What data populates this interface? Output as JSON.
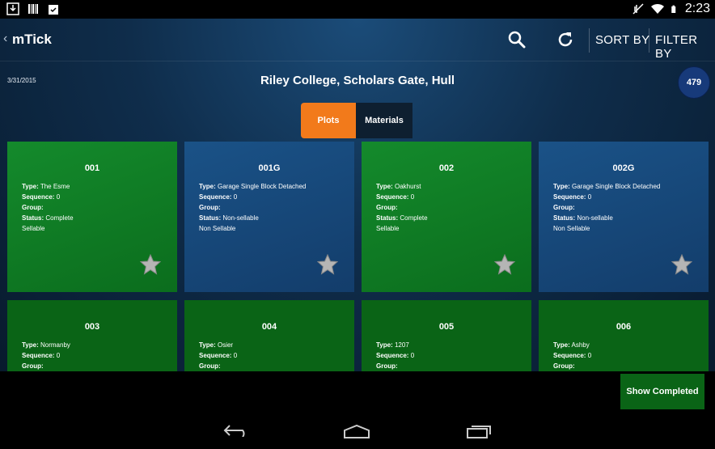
{
  "status": {
    "time": "2:23",
    "left_icons": [
      "download-icon",
      "barcode-icon",
      "clipboard-check-icon"
    ],
    "right_icons": [
      "mute-icon",
      "wifi-icon",
      "battery-icon"
    ]
  },
  "appbar": {
    "title": "mTick",
    "sort_label": "SORT BY",
    "filter_label": "FILTER BY",
    "icons": [
      "search-icon",
      "refresh-icon"
    ]
  },
  "header": {
    "date": "3/31/2015",
    "site": "Riley College, Scholars Gate, Hull",
    "count": "479"
  },
  "tabs": [
    {
      "label": "Plots",
      "active": true
    },
    {
      "label": "Materials",
      "active": false
    }
  ],
  "labels": {
    "type": "Type:",
    "sequence": "Sequence:",
    "group": "Group:",
    "status": "Status:"
  },
  "cards": [
    {
      "id": "001",
      "type": "The Esme",
      "sequence": "0",
      "group": "",
      "status": "Complete",
      "sellable": "Sellable",
      "color": "green"
    },
    {
      "id": "001G",
      "type": "Garage Single Block Detached",
      "sequence": "0",
      "group": "",
      "status": "Non-sellable",
      "sellable": "Non Sellable",
      "color": "blue"
    },
    {
      "id": "002",
      "type": "Oakhurst",
      "sequence": "0",
      "group": "",
      "status": "Complete",
      "sellable": "Sellable",
      "color": "green"
    },
    {
      "id": "002G",
      "type": "Garage Single Block Detached",
      "sequence": "0",
      "group": "",
      "status": "Non-sellable",
      "sellable": "Non Sellable",
      "color": "blue"
    },
    {
      "id": "003",
      "type": "Normanby",
      "sequence": "0",
      "group": "",
      "color": "dkgreen"
    },
    {
      "id": "004",
      "type": "Osier",
      "sequence": "0",
      "group": "",
      "color": "dkgreen"
    },
    {
      "id": "005",
      "type": "1207",
      "sequence": "0",
      "group": "",
      "color": "dkgreen"
    },
    {
      "id": "006",
      "type": "Ashby",
      "sequence": "0",
      "group": "",
      "color": "dkgreen"
    }
  ],
  "show_completed": "Show Completed",
  "nav_icons": [
    "back-icon",
    "home-icon",
    "recents-icon"
  ],
  "colors": {
    "accent": "#f27a1b",
    "green": "#148a2c",
    "blue": "#1a5287",
    "dark_green": "#0a6416"
  }
}
